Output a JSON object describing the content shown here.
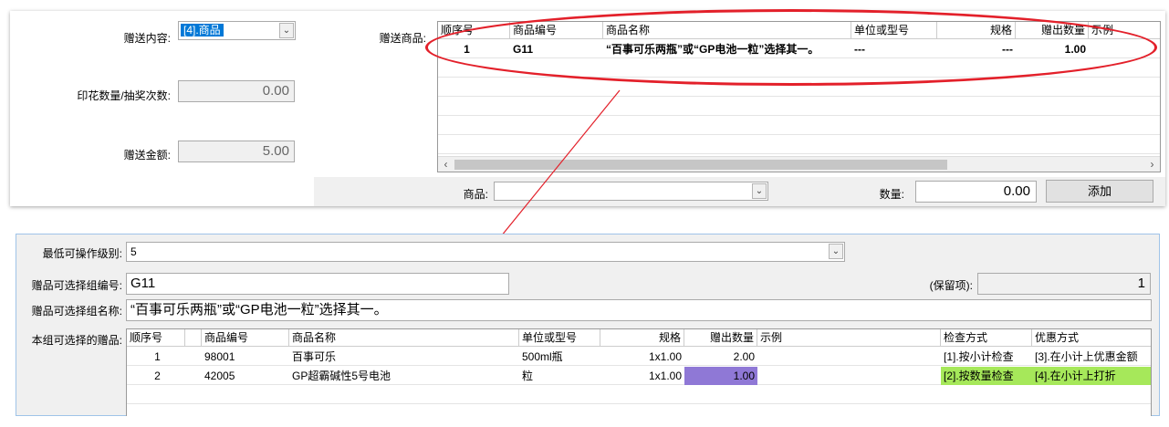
{
  "top": {
    "gift_content_label": "赠送内容:",
    "gift_content_value": "[4].商品",
    "stamp_label": "印花数量/抽奖次数:",
    "stamp_value": "0.00",
    "gift_amount_label": "赠送金额:",
    "gift_amount_value": "5.00",
    "gift_goods_label": "赠送商品:",
    "grid_headers": [
      "顺序号",
      "商品编号",
      "商品名称",
      "单位或型号",
      "规格",
      "赠出数量",
      "示例"
    ],
    "grid_rows": [
      {
        "seq": "1",
        "code": "G11",
        "name": "“百事可乐两瓶”或“GP电池一粒”选择其一。",
        "unit": "---",
        "spec": "---",
        "qty": "1.00",
        "example": ""
      }
    ],
    "goods_label": "商品:",
    "goods_value": "",
    "qty_label": "数量:",
    "qty_value": "0.00",
    "add_button": "添加"
  },
  "bottom": {
    "min_level_label": "最低可操作级别:",
    "min_level_value": "5",
    "group_code_label": "赠品可选择组编号:",
    "group_code_value": "G11",
    "reserved_label": "(保留项):",
    "reserved_value": "1",
    "group_name_label": "赠品可选择组名称:",
    "group_name_value": "“百事可乐两瓶”或“GP电池一粒”选择其一。",
    "selectable_label": "本组可选择的赠品:",
    "grid_headers": [
      "顺序号",
      "",
      "商品编号",
      "商品名称",
      "单位或型号",
      "规格",
      "赠出数量",
      "示例",
      "检查方式",
      "优惠方式"
    ],
    "grid_rows": [
      {
        "seq": "1",
        "code": "98001",
        "name": "百事可乐",
        "unit": "500ml瓶",
        "spec": "1x1.00",
        "qty": "2.00",
        "example": "",
        "check": "[1].按小计检查",
        "discount": "[3].在小计上优惠金额"
      },
      {
        "seq": "2",
        "code": "42005",
        "name": "GP超霸碱性5号电池",
        "unit": "粒",
        "spec": "1x1.00",
        "qty": "1.00",
        "example": "",
        "check": "[2].按数量检查",
        "discount": "[4].在小计上打折"
      }
    ]
  },
  "colors": {
    "annotation_red": "#e3202a",
    "qty_highlight": "#8f78d6",
    "check_highlight": "#a6e85a",
    "selection_blue": "#0078d7"
  }
}
